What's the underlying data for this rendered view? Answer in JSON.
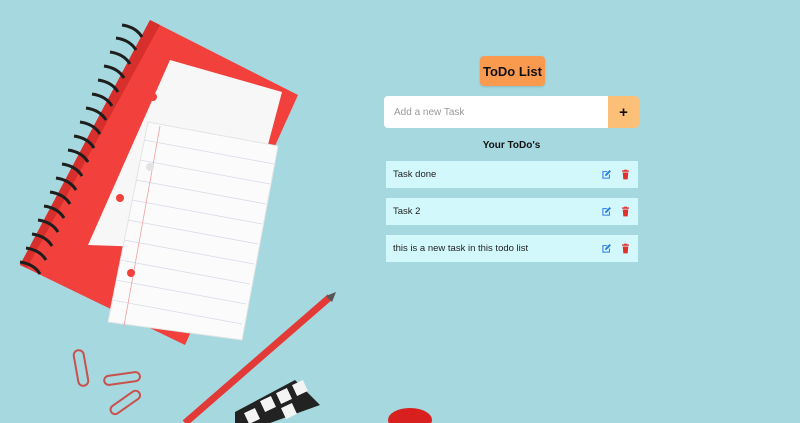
{
  "app": {
    "title": "ToDo List",
    "input_placeholder": "Add a new Task",
    "add_button_label": "+",
    "list_heading": "Your ToDo's"
  },
  "tasks": [
    {
      "text": "Task done",
      "edit_icon": "edit-icon",
      "delete_icon": "trash-icon"
    },
    {
      "text": "Task 2",
      "edit_icon": "edit-icon",
      "delete_icon": "trash-icon"
    },
    {
      "text": "this is a new task in this todo list",
      "edit_icon": "edit-icon",
      "delete_icon": "trash-icon"
    }
  ],
  "colors": {
    "background": "#a6d8e0",
    "title_button": "#fa9a4f",
    "add_button": "#fbbf78",
    "task_row": "#d2f8fc",
    "edit_icon": "#2f7de1",
    "delete_icon": "#e0312b"
  }
}
